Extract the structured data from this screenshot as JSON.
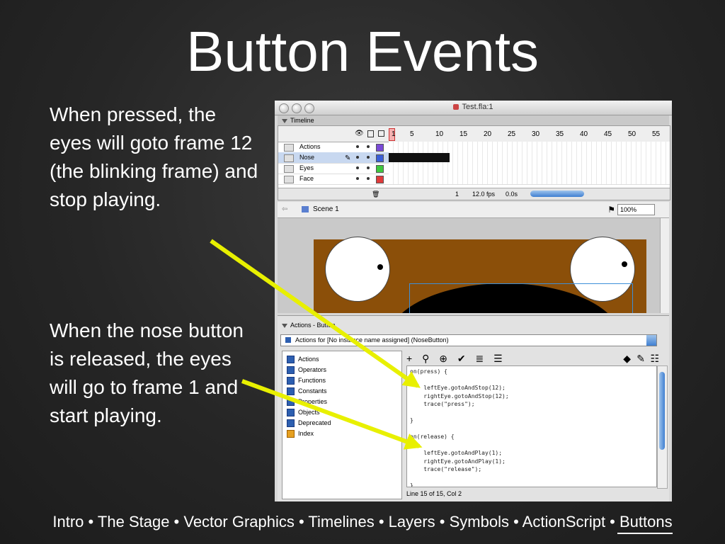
{
  "slide": {
    "title": "Button Events",
    "paragraph1": "When pressed, the eyes will goto frame 12 (the blinking frame) and stop playing.",
    "paragraph2": "When the nose button is released, the eyes will go to frame 1 and start playing.",
    "footer": "Intro • The Stage • Vector Graphics • Timelines • Layers • Symbols • ActionScript • Buttons"
  },
  "window": {
    "title": "Test.fla:1"
  },
  "timeline": {
    "label": "Timeline",
    "frame_numbers": [
      "1",
      "5",
      "10",
      "15",
      "20",
      "25",
      "30",
      "35",
      "40",
      "45",
      "50",
      "55"
    ],
    "layers": [
      {
        "name": "Actions",
        "color": "#7a4ad6"
      },
      {
        "name": "Nose",
        "color": "#3a5fd8"
      },
      {
        "name": "Eyes",
        "color": "#3ec83e"
      },
      {
        "name": "Face",
        "color": "#e03a3a"
      }
    ],
    "status": {
      "frame": "1",
      "fps": "12.0 fps",
      "time": "0.0s"
    }
  },
  "editbar": {
    "scene": "Scene 1",
    "zoom": "100%"
  },
  "actions_panel": {
    "title": "Actions - Button",
    "target": "Actions for [No instance name assigned] (NoseButton)",
    "tree_items": [
      {
        "label": "Actions",
        "icon": "book-icon"
      },
      {
        "label": "Operators",
        "icon": "book-icon"
      },
      {
        "label": "Functions",
        "icon": "book-icon"
      },
      {
        "label": "Constants",
        "icon": "book-icon"
      },
      {
        "label": "Properties",
        "icon": "book-icon"
      },
      {
        "label": "Objects",
        "icon": "book-icon"
      },
      {
        "label": "Deprecated",
        "icon": "book-icon"
      },
      {
        "label": "Index",
        "icon": "index-icon"
      }
    ],
    "code": "on(press) {\n\n    leftEye.gotoAndStop(12);\n    rightEye.gotoAndStop(12);\n    trace(\"press\");\n\n}\n\non(release) {\n\n    leftEye.gotoAndPlay(1);\n    rightEye.gotoAndPlay(1);\n    trace(\"release\");\n\n}",
    "status": "Line 15 of 15, Col 2"
  },
  "colors": {
    "arrow": "#e8f000",
    "face": "#8b4f09",
    "selection": "#3d8fd8"
  }
}
